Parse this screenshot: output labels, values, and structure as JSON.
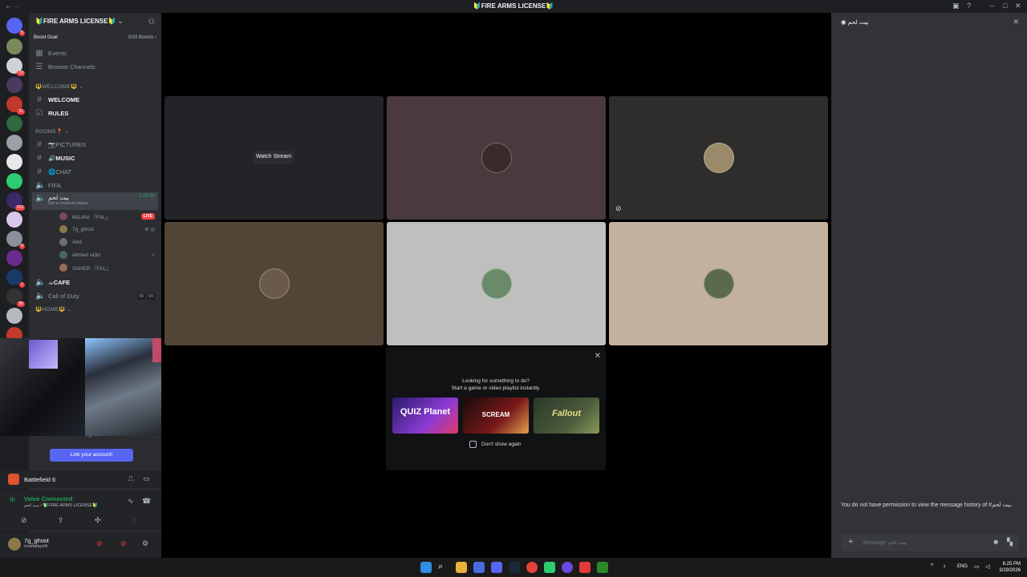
{
  "window": {
    "title": "🔰FIRE ARMS LICENSE🔰"
  },
  "server": {
    "name": "🔰FIRE ARMS LICENSE🔰",
    "boost_goal": "Boost Goal",
    "boost_count": "0/33 Boosts"
  },
  "nav": {
    "events": "Events",
    "browse": "Browse Channels"
  },
  "categories": {
    "welcome": "🔱WELCOME🔱",
    "rooms": "ROOMS📍",
    "home": "🔱HOME🔱"
  },
  "channels": {
    "welcome": "WELCOME",
    "rules": "RULES",
    "pictures": "📷PICTURES",
    "music": "🔊MUSIC",
    "chat": "🌐CHAT",
    "fifa": "FIFA",
    "voice_active": "بيت لحم",
    "voice_timer": "2:29:30",
    "voice_status": "Set a channel status",
    "cafe": "☕CAFE",
    "cod": "Call of Duty",
    "cod_count_a": "00",
    "cod_count_b": "99"
  },
  "members": [
    {
      "name": "MILANI 『FAL』",
      "badge": "LIVE"
    },
    {
      "name": "7g_ghost"
    },
    {
      "name": "Abd"
    },
    {
      "name": "ahmed ra3d"
    },
    {
      "name": "SAHER 『FAL』"
    }
  ],
  "link_account": {
    "text": "friends, messages, and even more!",
    "button": "Link your account!"
  },
  "activity": {
    "game": "Battlefield 6"
  },
  "voice": {
    "status": "Voice Connected",
    "location": "بيت لحم / 🔰FIRE ARMS LICENSE🔰"
  },
  "user": {
    "name": "7g_ghost",
    "tag": "mustafayelli"
  },
  "stage": {
    "watch_stream": "Watch Stream"
  },
  "promo": {
    "line1": "Looking for something to do?",
    "line2": "Start a game or video playlist instantly.",
    "dont_show": "Don't show again",
    "games": [
      "QUIZ Planet",
      "SCREAM",
      "Fallout"
    ]
  },
  "chat": {
    "header": "بيت لحم",
    "permission": "You do not have permission to view the message history of #بيت لحم.",
    "placeholder": "Message بيت لحم"
  },
  "taskbar": {
    "lang": "ENG",
    "time": "6:25 PM",
    "date": "3/29/2026"
  },
  "server_badges": [
    "5",
    "19",
    "21",
    "103",
    "9",
    "1",
    "95"
  ]
}
